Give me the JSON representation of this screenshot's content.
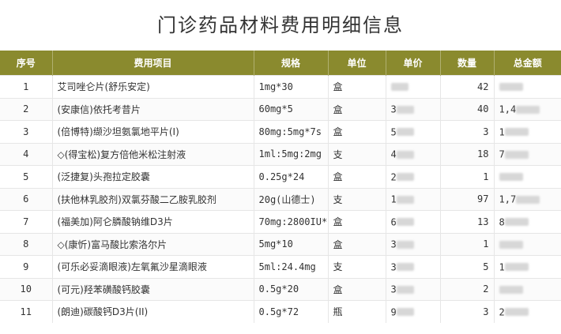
{
  "page": {
    "title": "门诊药品材料费用明细信息"
  },
  "table": {
    "headers": [
      "序号",
      "费用项目",
      "规格",
      "单位",
      "单价",
      "数量",
      "总金额"
    ],
    "rows": [
      {
        "index": "1",
        "name": "艾司唑仑片(舒乐安定)",
        "spec": "1mg*30",
        "unit": "盒",
        "price_visible": "",
        "qty": "42",
        "total_visible": ""
      },
      {
        "index": "2",
        "name": "(安康信)依托考昔片",
        "spec": "60mg*5",
        "unit": "盒",
        "price_visible": "3",
        "qty": "40",
        "total_visible": "1,4"
      },
      {
        "index": "3",
        "name": "(倍博特)缬沙坦氨氯地平片(Ⅰ)",
        "spec": "80mg:5mg*7s",
        "unit": "盒",
        "price_visible": "5",
        "qty": "3",
        "total_visible": "1"
      },
      {
        "index": "4",
        "name": "◇(得宝松)复方倍他米松注射液",
        "spec": "1ml:5mg:2mg",
        "unit": "支",
        "price_visible": "4",
        "qty": "18",
        "total_visible": "7"
      },
      {
        "index": "5",
        "name": "(泛捷复)头孢拉定胶囊",
        "spec": "0.25g*24",
        "unit": "盒",
        "price_visible": "2",
        "qty": "1",
        "total_visible": ""
      },
      {
        "index": "6",
        "name": "(扶他林乳胶剂)双氯芬酸二乙胺乳胶剂",
        "spec": "20g(山德士)",
        "unit": "支",
        "price_visible": "1",
        "qty": "97",
        "total_visible": "1,7"
      },
      {
        "index": "7",
        "name": "(福美加)阿仑膦酸钠维D3片",
        "spec": "70mg:2800IU*",
        "unit": "盒",
        "price_visible": "6",
        "qty": "13",
        "total_visible": "8"
      },
      {
        "index": "8",
        "name": "◇(康忻)富马酸比索洛尔片",
        "spec": "5mg*10",
        "unit": "盒",
        "price_visible": "3",
        "qty": "1",
        "total_visible": ""
      },
      {
        "index": "9",
        "name": "(可乐必妥滴眼液)左氧氟沙星滴眼液",
        "spec": "5ml:24.4mg",
        "unit": "支",
        "price_visible": "3",
        "qty": "5",
        "total_visible": "1"
      },
      {
        "index": "10",
        "name": "(可元)羟苯磺酸钙胶囊",
        "spec": "0.5g*20",
        "unit": "盒",
        "price_visible": "3",
        "qty": "2",
        "total_visible": ""
      },
      {
        "index": "11",
        "name": "(朗迪)碳酸钙D3片(II)",
        "spec": "0.5g*72",
        "unit": "瓶",
        "price_visible": "9",
        "qty": "3",
        "total_visible": "2"
      }
    ]
  },
  "colors": {
    "header_bg": "#8a8a2e",
    "header_text": "#ffffff",
    "redaction": "#d7d7d7"
  }
}
